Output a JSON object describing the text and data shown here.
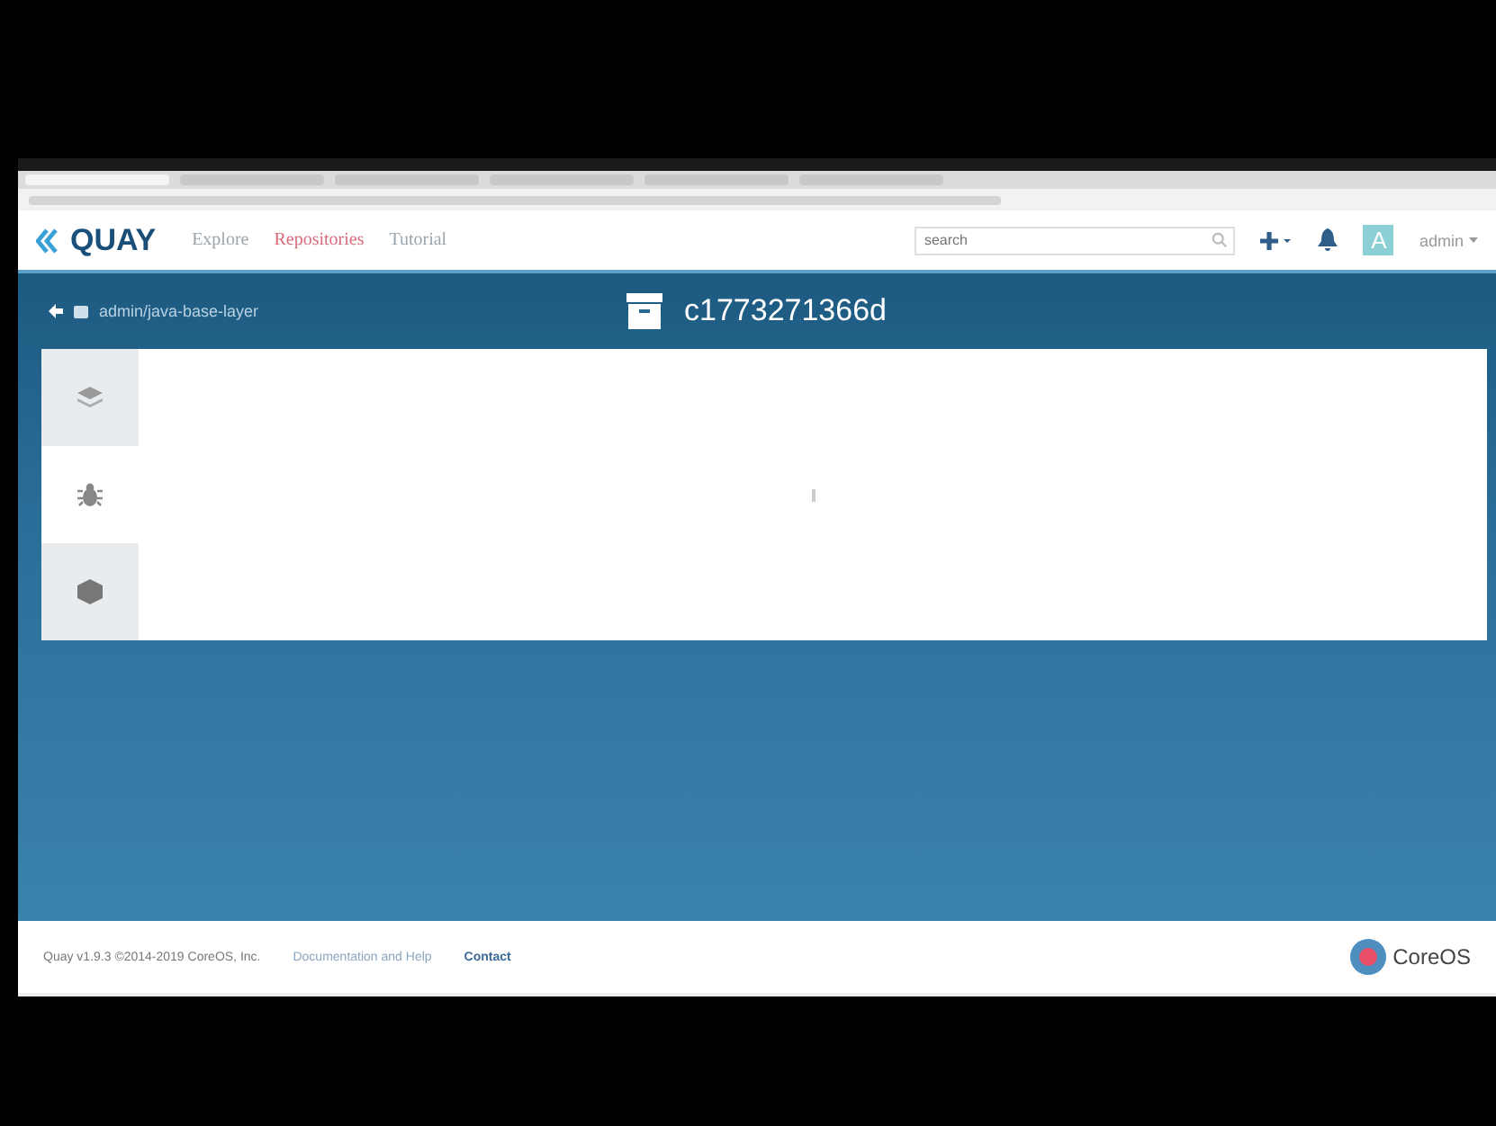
{
  "browser_tabs": [
    {
      "selected": true
    },
    {
      "selected": false
    },
    {
      "selected": false
    },
    {
      "selected": false
    },
    {
      "selected": false
    },
    {
      "selected": false
    }
  ],
  "header": {
    "logo": "QUAY",
    "nav": [
      {
        "label": "Explore",
        "selected": false
      },
      {
        "label": "Repositories",
        "selected": true
      },
      {
        "label": "Tutorial",
        "selected": false
      }
    ],
    "search": {
      "placeholder": "search"
    },
    "avatar": "A",
    "user": "admin"
  },
  "breadcrumb": "admin/java-base-layer",
  "title": "c1773271366d",
  "side_tabs": [
    {
      "kind": "layers",
      "selected": false
    },
    {
      "kind": "bug",
      "selected": true
    },
    {
      "kind": "package",
      "selected": false
    }
  ],
  "footer": {
    "version": "Quay v1.9.3 ©2014-2019 CoreOS, Inc.",
    "links": [
      "Documentation and Help",
      "Contact"
    ],
    "logo": "CoreOS"
  }
}
